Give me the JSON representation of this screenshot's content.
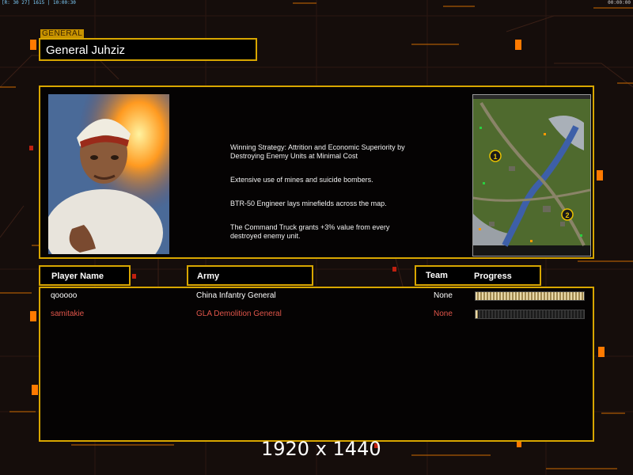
{
  "hud": {
    "top_left": "[R: 30 27] 1615 | 10:00:30",
    "top_right": "00:00:00"
  },
  "general": {
    "tag": "GENERAL",
    "name": "General Juhziz"
  },
  "strategy": [
    "Winning Strategy: Attrition and Economic Superiority by\n Destroying Enemy Units at Minimal Cost",
    "Extensive use of mines and suicide bombers.",
    "BTR-50 Engineer lays minefields across the map.",
    "The Command Truck grants +3% value from every\n destroyed enemy unit."
  ],
  "minimap": {
    "markers": [
      "1",
      "2"
    ]
  },
  "table": {
    "headers": {
      "player_name": "Player Name",
      "army": "Army",
      "team": "Team",
      "progress": "Progress"
    },
    "rows": [
      {
        "player": "qooooo",
        "army": "China Infantry General",
        "team": "None",
        "progress": 1.0,
        "color": "#ffffff"
      },
      {
        "player": "samitakie",
        "army": "GLA Demolition General",
        "team": "None",
        "progress": 0.02,
        "color": "#e0554a"
      }
    ]
  },
  "resolution_label": "1920 x 1440",
  "colors": {
    "accent": "#d8a600",
    "background": "#150d0b",
    "enemy": "#e0554a"
  }
}
